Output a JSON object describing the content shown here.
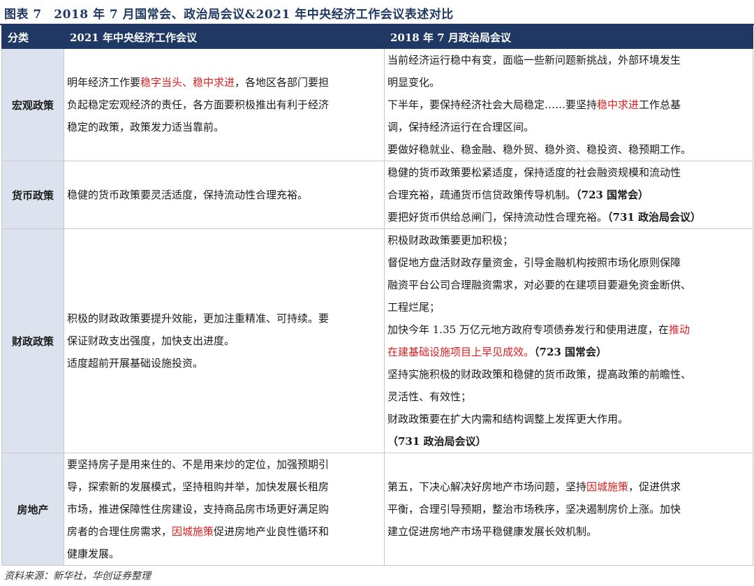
{
  "title": "图表 7　2018 年 7 月国常会、政治局会议&2021 年中央经济工作会议表述对比",
  "headers": [
    "分类",
    "2021 年中央经济工作会议",
    "2018 年 7 月政治局会议"
  ],
  "rows": [
    {
      "category": "宏观政策",
      "col1": [
        [
          {
            "t": "明年经济工作要"
          },
          {
            "t": "稳字当头、稳中求进",
            "s": "red"
          },
          {
            "t": "，各地区各部门要担"
          }
        ],
        [
          {
            "t": "负起稳定宏观经济的责任，各方面要积极推出有利于经济"
          }
        ],
        [
          {
            "t": "稳定的政策，政策发力适当靠前。"
          }
        ]
      ],
      "col2": [
        [
          {
            "t": "当前经济运行稳中有变，面临一些新问题新挑战，外部环境发生"
          }
        ],
        [
          {
            "t": "明显变化。"
          }
        ],
        [
          {
            "t": "下半年，要保持经济社会大局稳定……要坚持"
          },
          {
            "t": "稳中求进",
            "s": "red"
          },
          {
            "t": "工作总基"
          }
        ],
        [
          {
            "t": "调，保持经济运行在合理区间。"
          }
        ],
        [
          {
            "t": "要做好稳就业、稳金融、稳外贸、稳外资、稳投资、稳预期工作。"
          }
        ]
      ]
    },
    {
      "category": "货币政策",
      "col1": [
        [
          {
            "t": "稳健的货币政策要灵活适度，保持流动性合理充裕。"
          }
        ]
      ],
      "col2": [
        [
          {
            "t": "稳健的货币政策要松紧适度，保持适度的社会融资规模和流动性"
          }
        ],
        [
          {
            "t": "合理充裕，疏通货币信贷政策传导机制。"
          },
          {
            "t": "（723 国常会）",
            "s": "b"
          }
        ],
        [
          {
            "t": "要把好货币供给总闸门，保持流动性合理充裕。"
          },
          {
            "t": "（731 政治局会议）",
            "s": "b"
          }
        ]
      ]
    },
    {
      "category": "财政政策",
      "col1": [
        [
          {
            "t": "积极的财政政策要提升效能，更加注重精准、可持续。要"
          }
        ],
        [
          {
            "t": "保证财政支出强度，加快支出进度。"
          }
        ],
        [
          {
            "t": "适度超前开展基础设施投资。"
          }
        ]
      ],
      "col2": [
        [
          {
            "t": "积极财政政策要更加积极；"
          }
        ],
        [
          {
            "t": "督促地方盘活财政存量资金，引导金融机构按照市场化原则保障"
          }
        ],
        [
          {
            "t": "融资平台公司合理融资需求，对必要的在建项目要避免资金断供、"
          }
        ],
        [
          {
            "t": "工程烂尾；"
          }
        ],
        [
          {
            "t": "加快今年 1.35 万亿元地方政府专项债券发行和使用进度，在"
          },
          {
            "t": "推动",
            "s": "red"
          }
        ],
        [
          {
            "t": "在建基础设施项目上早见成效。",
            "s": "red"
          },
          {
            "t": "（723 国常会）",
            "s": "b"
          }
        ],
        [
          {
            "t": "坚持实施积极的财政政策和稳健的货币政策，提高政策的前瞻性、"
          }
        ],
        [
          {
            "t": "灵活性、有效性；"
          }
        ],
        [
          {
            "t": "财政政策要在扩大内需和结构调整上发挥更大作用。"
          }
        ],
        [
          {
            "t": "（731 政治局会议）",
            "s": "b"
          }
        ]
      ]
    },
    {
      "category": "房地产",
      "col1": [
        [
          {
            "t": "要坚持房子是用来住的、不是用来炒的定位，加强预期引"
          }
        ],
        [
          {
            "t": "导，探索新的发展模式，坚持租购并举，加快发展长租房"
          }
        ],
        [
          {
            "t": "市场，推进保障性住房建设，支持商品房市场更好满足购"
          }
        ],
        [
          {
            "t": "房者的合理住房需求，"
          },
          {
            "t": "因城施策",
            "s": "red"
          },
          {
            "t": "促进房地产业良性循环和"
          }
        ],
        [
          {
            "t": "健康发展。"
          }
        ]
      ],
      "col2": [
        [
          {
            "t": "第五，下决心解决好房地产市场问题，坚持"
          },
          {
            "t": "因城施策",
            "s": "red"
          },
          {
            "t": "，促进供求"
          }
        ],
        [
          {
            "t": "平衡，合理引导预期，整治市场秩序，坚决遏制房价上涨。加快"
          }
        ],
        [
          {
            "t": "建立促进房地产市场平稳健康发展长效机制。"
          }
        ]
      ]
    }
  ],
  "source": "资料来源：新华社，华创证券整理"
}
